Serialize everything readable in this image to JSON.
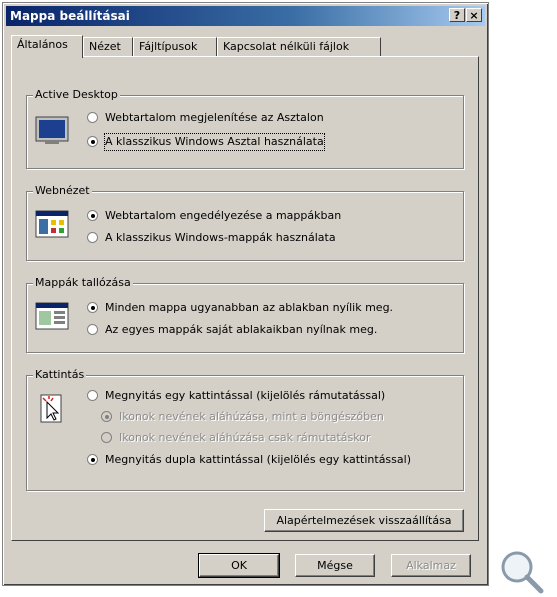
{
  "window": {
    "title": "Mappa beállításai",
    "help_btn": "?",
    "close_btn": "×"
  },
  "tabs": [
    "Általános",
    "Nézet",
    "Fájltípusok",
    "Kapcsolat nélküli fájlok"
  ],
  "groups": {
    "active_desktop": {
      "legend": "Active Desktop",
      "icon": "desktop-monitor-icon",
      "options": [
        "Webtartalom megjelenítése az Asztalon",
        "A klasszikus Windows Asztal használata"
      ],
      "selected": 1
    },
    "webview": {
      "legend": "Webnézet",
      "icon": "web-folder-icon",
      "options": [
        "Webtartalom engedélyezése a mappákban",
        "A klasszikus Windows-mappák használata"
      ],
      "selected": 0
    },
    "browse": {
      "legend": "Mappák tallózása",
      "icon": "window-browse-icon",
      "options": [
        "Minden mappa ugyanabban az ablakban nyílik meg.",
        "Az egyes mappák saját ablakaikban nyílnak meg."
      ],
      "selected": 0
    },
    "click": {
      "legend": "Kattintás",
      "icon": "click-cursor-icon",
      "options": [
        "Megnyitás egy kattintással (kijelölés rámutatással)",
        "Ikonok nevének aláhúzása, mint a böngészőben",
        "Ikonok nevének aláhúzása csak rámutatáskor",
        "Megnyitás dupla kattintással (kijelölés egy kattintással)"
      ],
      "selected": 3
    }
  },
  "restore_btn": "Alapértelmezések visszaállítása",
  "buttons": {
    "ok": "OK",
    "cancel": "Mégse",
    "apply": "Alkalmaz"
  },
  "zoom_icon": "magnifier-icon"
}
